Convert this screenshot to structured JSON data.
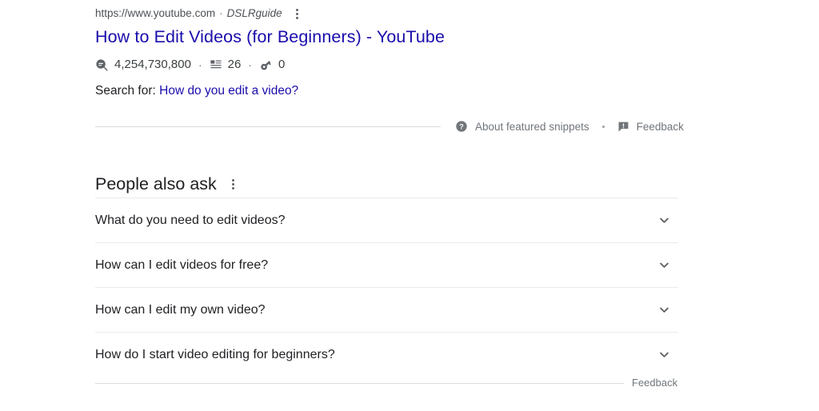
{
  "snippet": {
    "url": "https://www.youtube.com",
    "separator": "·",
    "site": "DSLRguide",
    "menu_icon": "three-dots-vertical-icon",
    "title": "How to Edit Videos (for Beginners) - YouTube",
    "stats": {
      "views_icon": "magnifier-filled-icon",
      "views": "4,254,730,800",
      "sep1": "·",
      "articles_icon": "article-list-icon",
      "articles": "26",
      "sep2": "·",
      "keys_icon": "key-icon",
      "keys": "0"
    },
    "search_for_label": "Search for:",
    "search_for_query": "How do you edit a video?",
    "footer": {
      "about_icon": "question-mark-circle-icon",
      "about_label": "About featured snippets",
      "separator_dot": "•",
      "feedback_icon": "feedback-exclamation-icon",
      "feedback_label": "Feedback"
    }
  },
  "people_also_ask": {
    "heading": "People also ask",
    "menu_icon": "three-dots-vertical-icon",
    "expand_icon": "chevron-down-icon",
    "questions": [
      "What do you need to edit videos?",
      "How can I edit videos for free?",
      "How can I edit my own video?",
      "How do I start video editing for beginners?"
    ],
    "feedback_label": "Feedback"
  },
  "colors": {
    "link_blue": "#1a0dab",
    "text_primary": "#202124",
    "text_secondary": "#4d5156",
    "text_muted": "#70757a",
    "icon_gray": "#5f6368",
    "divider": "#dadce0",
    "divider_light": "#ebebeb",
    "background": "#ffffff"
  }
}
